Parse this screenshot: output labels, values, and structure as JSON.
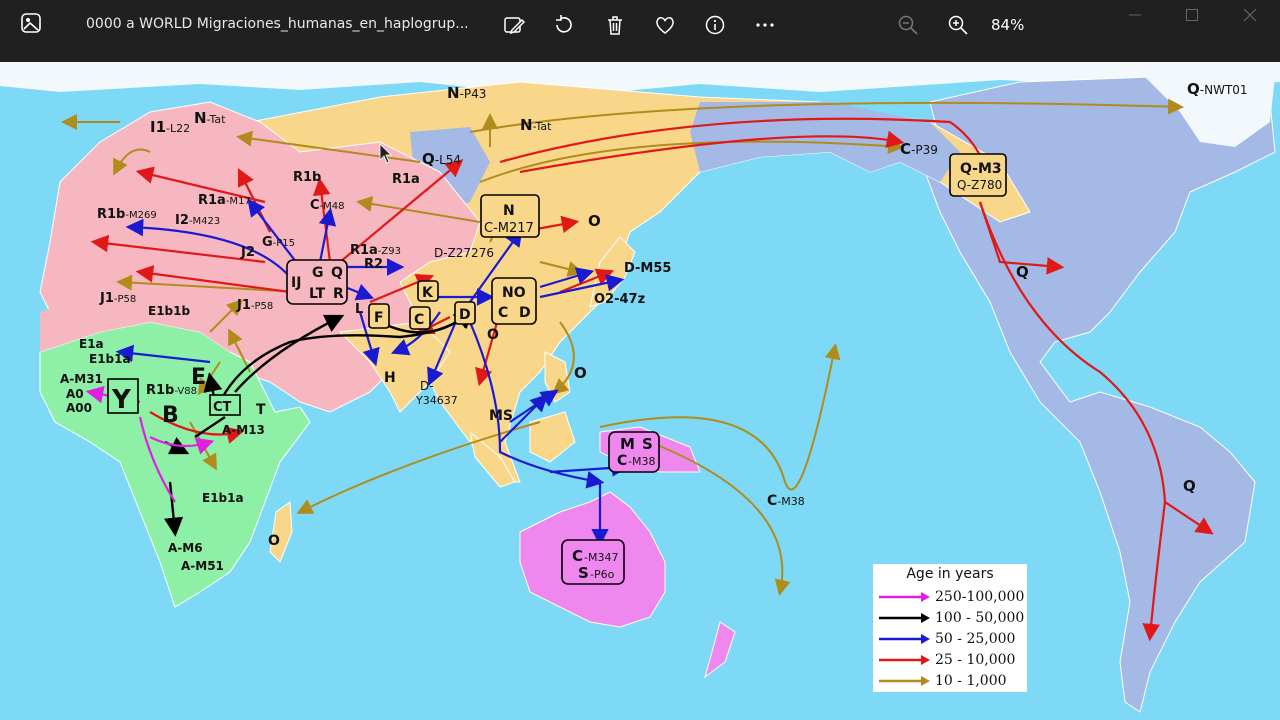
{
  "window": {
    "title": "0000 a WORLD Migraciones_humanas_en_haplogrup...",
    "zoom": "84%"
  },
  "toolbar": {
    "icons": [
      "edit-image-icon",
      "rotate-icon",
      "delete-icon",
      "favorite-heart-icon",
      "info-icon",
      "more-icon",
      "zoom-out-icon",
      "zoom-in-icon"
    ]
  },
  "colors": {
    "ocean": "#7dd9f5",
    "europe_mideast": "#f6b7c1",
    "africa": "#8ef0a6",
    "asia": "#f8d78a",
    "americas_siberia": "#a4b9e6",
    "australia": "#ee88ee",
    "arrow_250k": "#e020e0",
    "arrow_100k": "#000000",
    "arrow_50k": "#1a1ad0",
    "arrow_25k": "#e01818",
    "arrow_10k": "#b08c1c"
  },
  "map": {
    "labels": {
      "n_p43_main": "N",
      "n_p43_sub": "-P43",
      "q_nwt01_main": "Q",
      "q_nwt01_sub": "-NWT01",
      "i1_main": "I1",
      "i1_sub": "-L22",
      "n_tat_w_main": "N",
      "n_tat_w_sub": "-Tat",
      "n_tat_e_main": "N",
      "n_tat_e_sub": "-Tat",
      "q_l54_main": "Q",
      "q_l54_sub": "-L54",
      "r1b_main": "R1b",
      "r1a_main": "R1a",
      "c_p39_main": "C",
      "c_p39_sub": "-P39",
      "r1a_m17_main": "R1a",
      "r1a_m17_sub": "-M17",
      "r1b_m269_main": "R1b",
      "r1b_m269_sub": "-M269",
      "i2_main": "I2",
      "i2_sub": "-M423",
      "c_m48_main": "C",
      "c_m48_sub": "-M48",
      "g_p15_main": "G",
      "g_p15_sub": "-P15",
      "j2_main": "J2",
      "r1a_z93_main": "R1a",
      "r1a_z93_sub": "-Z93",
      "r2_main": "R2",
      "d_z27276": "D-Z27276",
      "o_north": "O",
      "d_m55": "D-M55",
      "o2_47z": "O2-47z",
      "j1_west_main": "J1",
      "j1_west_sub": "-P58",
      "j1_east_main": "J1",
      "j1_east_sub": "-P58",
      "e1b1b": "E1b1b",
      "l_main": "L",
      "o_box_below": "O",
      "e1a": "E1a",
      "e1b1a_w": "E1b1a",
      "a_m31": "A-M31",
      "a0": "A0",
      "a00": "A00",
      "r1b_v88_main": "R1b",
      "r1b_v88_sub": "-V88",
      "e_main": "E",
      "b_main": "B",
      "t_main": "T",
      "a_m13": "A-M13",
      "h_main": "H",
      "d_y34637_a": "D-",
      "d_y34637_b": "Y34637",
      "ms_main": "MS",
      "o_philippines": "O",
      "e1b1a_s": "E1b1a",
      "a_m6": "A-M6",
      "a_m51": "A-M51",
      "o_madagascar": "O",
      "c_m38_main": "C",
      "c_m38_sub": "-M38",
      "q_na": "Q",
      "q_sa": "Q"
    },
    "boxes": {
      "qm3_a": "Q-M3",
      "qm3_b": "Q-Z780",
      "nc_a": "N",
      "nc_b": "C-M217",
      "ijg_a": "IJ",
      "ijg_b": "G",
      "ijg_c": "Q",
      "ijg_d": "LT",
      "ijg_e": "R",
      "k": "K",
      "f": "F",
      "c": "C",
      "d": "D",
      "no_a": "NO",
      "no_b": "C",
      "no_c": "D",
      "y": "Y",
      "ct": "CT",
      "ms_a": "M",
      "ms_b": "S",
      "ms_c": "C",
      "ms_d": "-M38",
      "cs_a": "C",
      "cs_b": "-M347",
      "cs_c": "S",
      "cs_d": "-P6o"
    }
  },
  "legend": {
    "title": "Age in years",
    "rows": [
      {
        "label": "250-100,000",
        "color": "#e020e0"
      },
      {
        "label": "100 - 50,000",
        "color": "#000000"
      },
      {
        "label": "50 - 25,000",
        "color": "#1a1ad0"
      },
      {
        "label": "25 - 10,000",
        "color": "#e01818"
      },
      {
        "label": "10  -  1,000",
        "color": "#b08c1c"
      }
    ]
  }
}
